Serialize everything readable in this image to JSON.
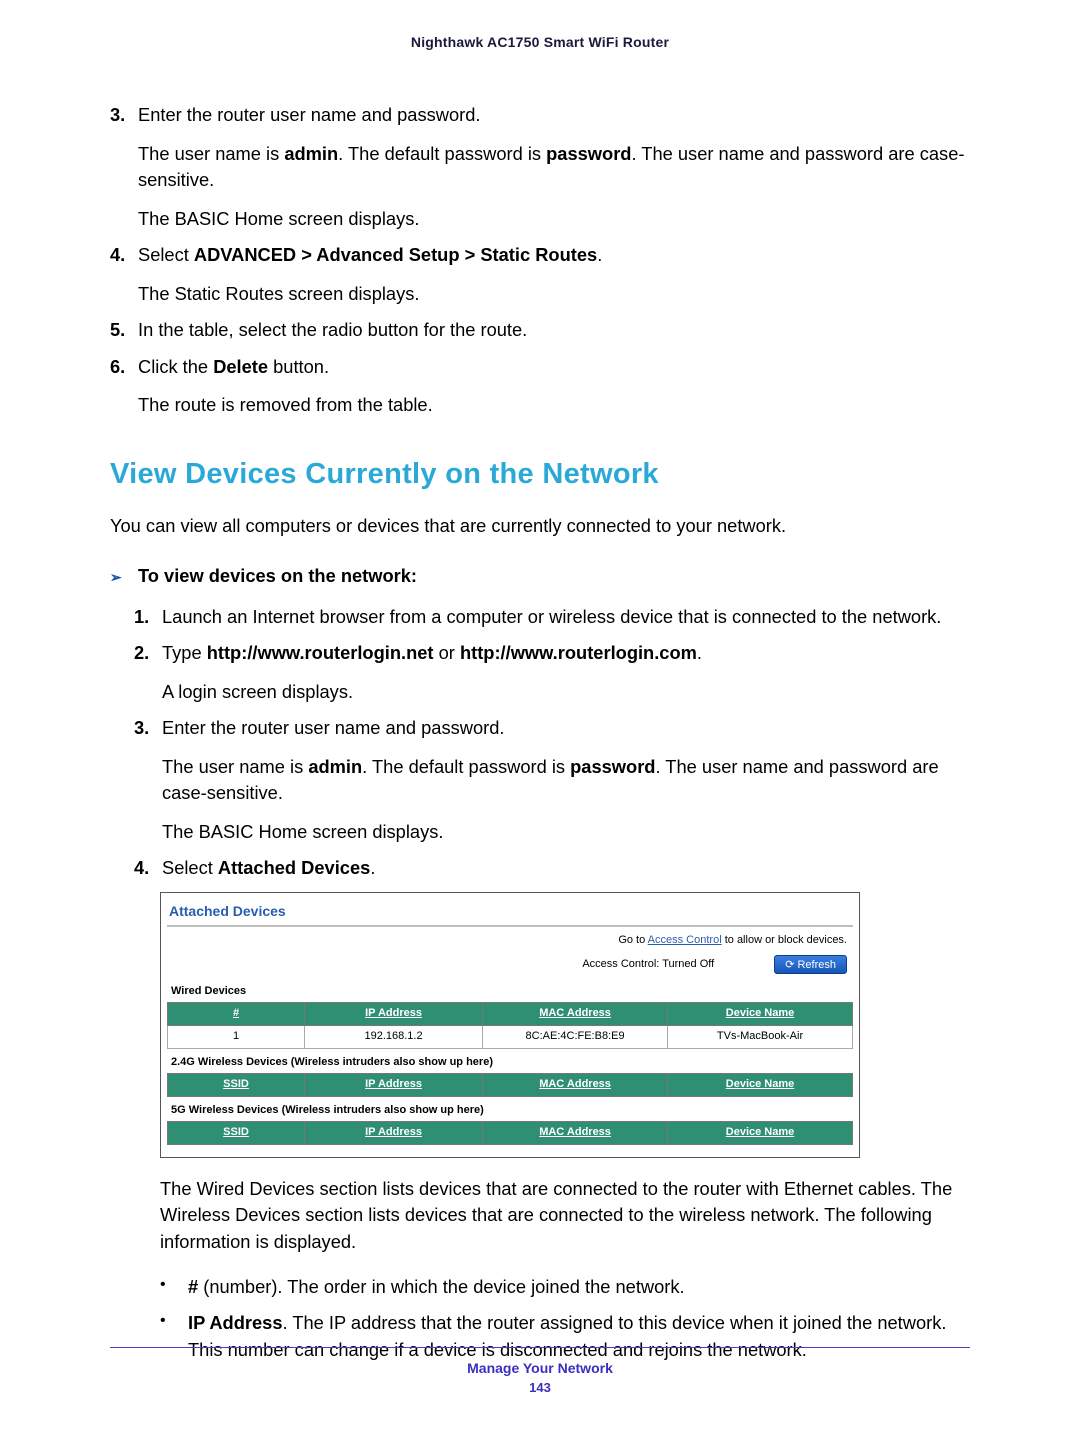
{
  "header": {
    "title": "Nighthawk AC1750 Smart WiFi Router"
  },
  "listA": {
    "items": [
      {
        "num": "3.",
        "line1": "Enter the router user name and password.",
        "line2_pre": "The user name is ",
        "line2_b1": "admin",
        "line2_mid": ". The default password is ",
        "line2_b2": "password",
        "line2_post": ". The user name and password are case-sensitive.",
        "line3": "The BASIC Home screen displays."
      },
      {
        "num": "4.",
        "line1_pre": "Select ",
        "line1_b": "ADVANCED > Advanced Setup > Static Routes",
        "line1_post": ".",
        "line2": "The Static Routes screen displays."
      },
      {
        "num": "5.",
        "line1": "In the table, select the radio button for the route."
      },
      {
        "num": "6.",
        "line1_pre": "Click the ",
        "line1_b": "Delete",
        "line1_post": " button.",
        "line2": "The route is removed from the table."
      }
    ]
  },
  "section": {
    "title": "View Devices Currently on the Network",
    "intro": "You can view all computers or devices that are currently connected to your network.",
    "task_head": "To view devices on the network:",
    "steps": [
      {
        "num": "1.",
        "text": "Launch an Internet browser from a computer or wireless device that is connected to the network."
      },
      {
        "num": "2.",
        "pre": "Type ",
        "b1": "http://www.routerlogin.net",
        "mid": " or ",
        "b2": "http://www.routerlogin.com",
        "post": ".",
        "sub": "A login screen displays."
      },
      {
        "num": "3.",
        "text": "Enter the router user name and password.",
        "sub_pre": "The user name is ",
        "sub_b1": "admin",
        "sub_mid": ". The default password is ",
        "sub_b2": "password",
        "sub_post": ". The user name and password are case-sensitive.",
        "sub2": "The BASIC Home screen displays."
      },
      {
        "num": "4.",
        "pre": "Select ",
        "b1": "Attached Devices",
        "post": "."
      }
    ]
  },
  "screenshot": {
    "title": "Attached Devices",
    "top_text_pre": "Go to ",
    "top_link": "Access Control",
    "top_text_post": " to allow or block devices.",
    "ac_status": "Access Control: Turned Off",
    "refresh": "Refresh",
    "wired_label": "Wired Devices",
    "cols_wired": {
      "c1": "#",
      "c2": "IP Address",
      "c3": "MAC Address",
      "c4": "Device Name"
    },
    "wired_row": {
      "c1": "1",
      "c2": "192.168.1.2",
      "c3": "8C:AE:4C:FE:B8:E9",
      "c4": "TVs-MacBook-Air"
    },
    "w24_label": "2.4G Wireless Devices (Wireless intruders also show up here)",
    "cols_wless": {
      "c1": "SSID",
      "c2": "IP Address",
      "c3": "MAC Address",
      "c4": "Device Name"
    },
    "w5_label": "5G Wireless Devices (Wireless intruders also show up here)"
  },
  "after_ss": {
    "para": "The Wired Devices section lists devices that are connected to the router with Ethernet cables. The Wireless Devices section lists devices that are connected to the wireless network. The following information is displayed.",
    "bullets": [
      {
        "b": "#",
        "rest": " (number). The order in which the device joined the network."
      },
      {
        "b": "IP Address",
        "rest": ". The IP address that the router assigned to this device when it joined the network. This number can change if a device is disconnected and rejoins the network."
      }
    ]
  },
  "footer": {
    "title": "Manage Your Network",
    "page": "143"
  }
}
